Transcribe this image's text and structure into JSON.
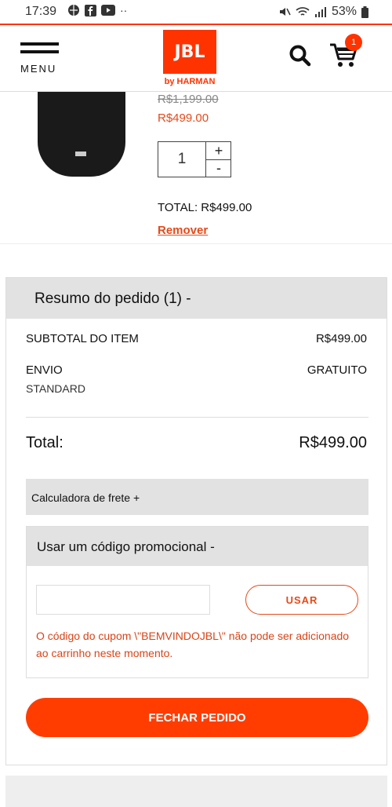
{
  "status_bar": {
    "time": "17:39",
    "battery": "53%"
  },
  "header": {
    "menu_label": "MENU",
    "logo_text": "JBL",
    "logo_sub": "by HARMAN",
    "cart_count": "1"
  },
  "cart_item": {
    "old_price": "R$1,199.00",
    "new_price": "R$499.00",
    "quantity": "1",
    "plus": "+",
    "minus": "-",
    "total": "TOTAL: R$499.00",
    "remove_label": "Remover"
  },
  "summary": {
    "title": "Resumo do pedido (1) -",
    "subtotal_label": "SUBTOTAL DO ITEM",
    "subtotal_value": "R$499.00",
    "shipping_label": "ENVIO",
    "shipping_value": "GRATUITO",
    "shipping_method": "STANDARD",
    "total_label": "Total:",
    "total_value": "R$499.00",
    "freight_calc_label": "Calculadora de frete  +",
    "promo": {
      "title": "Usar um código promocional -",
      "input_value": "",
      "button_label": "USAR",
      "error_message": "O código do cupom \\\"BEMVINDOJBL\\\" não pode ser adicionado ao carrinho neste momento."
    },
    "checkout_label": "FECHAR PEDIDO"
  },
  "colors": {
    "accent": "#ff3300",
    "error": "#d94418",
    "panel": "#e2e2e2"
  }
}
